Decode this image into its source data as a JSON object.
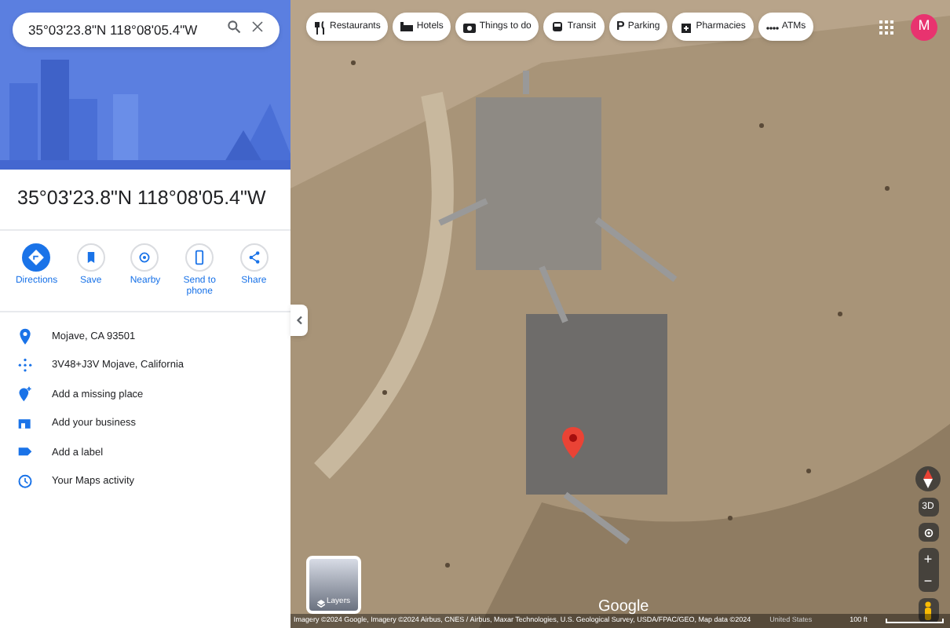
{
  "search": {
    "value": "35°03'23.8\"N 118°08'05.4\"W"
  },
  "place": {
    "title": "35°03'23.8\"N 118°08'05.4\"W"
  },
  "actions": [
    {
      "kind": "directions",
      "label": "Directions",
      "primary": true
    },
    {
      "kind": "save",
      "label": "Save",
      "primary": false
    },
    {
      "kind": "nearby",
      "label": "Nearby",
      "primary": false
    },
    {
      "kind": "phone",
      "label": "Send to phone",
      "primary": false
    },
    {
      "kind": "share",
      "label": "Share",
      "primary": false
    }
  ],
  "details": [
    {
      "kind": "pin",
      "label": "Mojave, CA 93501"
    },
    {
      "kind": "pluscode",
      "label": "3V48+J3V Mojave, California"
    },
    {
      "kind": "addplace",
      "label": "Add a missing place"
    },
    {
      "kind": "business",
      "label": "Add your business"
    },
    {
      "kind": "tag",
      "label": "Add a label"
    },
    {
      "kind": "history",
      "label": "Your Maps activity"
    }
  ],
  "chips": [
    {
      "kind": "fork",
      "label": "Restaurants"
    },
    {
      "kind": "bed",
      "label": "Hotels"
    },
    {
      "kind": "camera",
      "label": "Things to do"
    },
    {
      "kind": "train",
      "label": "Transit"
    },
    {
      "kind": "p",
      "label": "Parking",
      "icon_text": "P"
    },
    {
      "kind": "pharmacy",
      "label": "Pharmacies"
    },
    {
      "kind": "dots",
      "label": "ATMs"
    }
  ],
  "account": {
    "initial": "M"
  },
  "map": {
    "layers_label": "Layers",
    "logo": "Google",
    "zoom_in": "+",
    "zoom_out": "−",
    "tilt": "3D",
    "attribution": "Imagery ©2024 Google, Imagery ©2024 Airbus, CNES / Airbus, Maxar Technologies, U.S. Geological Survey, USDA/FPAC/GEO, Map data ©2024",
    "region": "United States",
    "scale": "100 ft"
  }
}
